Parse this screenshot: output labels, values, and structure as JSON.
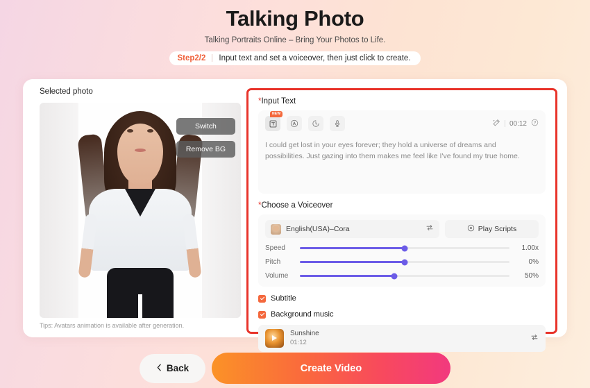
{
  "header": {
    "title": "Talking Photo",
    "subtitle": "Talking Portraits Online – Bring Your Photos to Life.",
    "step_label": "Step2/2",
    "step_text": "Input text and set a voiceover, then just click to create."
  },
  "left": {
    "panel_label": "Selected photo",
    "switch_label": "Switch",
    "remove_bg_label": "Remove BG",
    "tips": "Tips: Avatars animation is available after generation."
  },
  "input_text": {
    "label": "*Input Text",
    "required_mark": "*",
    "label_text": "Input Text",
    "toolbar": {
      "text_tool": "text-tool-icon",
      "new_badge": "NEW",
      "ai_tool": "ai-circle-icon",
      "history_tool": "history-clock-icon",
      "mic_tool": "microphone-icon",
      "magic_icon": "magic-wand-icon",
      "duration": "00:12",
      "help_icon": "help-circle-icon"
    },
    "value": "I could get lost in your eyes forever; they hold a universe of dreams and possibilities. Just gazing into them makes me feel like I've found my true home."
  },
  "voiceover": {
    "label": "*Choose a Voiceover",
    "required_mark": "*",
    "label_text": "Choose a Voiceover",
    "selected_voice": "English(USA)–Cora",
    "swap_icon": "swap-horizontal-icon",
    "play_scripts_label": "Play Scripts",
    "play_icon": "play-circle-icon",
    "sliders": [
      {
        "name": "Speed",
        "value": "1.00x",
        "percent": 50
      },
      {
        "name": "Pitch",
        "value": "0%",
        "percent": 50
      },
      {
        "name": "Volume",
        "value": "50%",
        "percent": 45
      }
    ]
  },
  "options": {
    "subtitle_label": "Subtitle",
    "subtitle_checked": true,
    "bgm_label": "Background music",
    "bgm_checked": true,
    "bgm_track_name": "Sunshine",
    "bgm_track_time": "01:12",
    "bgm_swap_icon": "swap-horizontal-icon"
  },
  "footer": {
    "back_label": "Back",
    "back_icon": "chevron-left-icon",
    "create_label": "Create Video"
  },
  "colors": {
    "accent_red": "#e8332a",
    "step_orange": "#f0603a",
    "slider_purple": "#6c5ce7",
    "checkbox_orange": "#f4683d"
  }
}
